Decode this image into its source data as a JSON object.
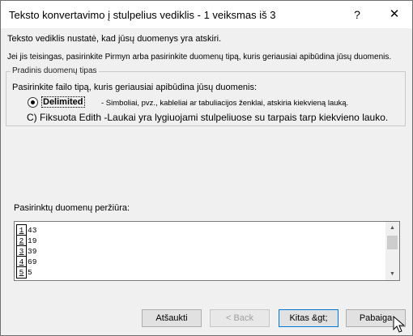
{
  "window": {
    "title": "Teksto konvertavimo į stulpelius vediklis - 1 veiksmas iš 3",
    "help_label": "?",
    "close_label": "✕"
  },
  "intro": {
    "line1": "Teksto vediklis nustatė, kad jūsų duomenys yra atskiri.",
    "line2": "Jei jis teisingas, pasirinkite Pirmyn arba pasirinkite duomenų tipą, kuris geriausiai apibūdina jūsų duomenis."
  },
  "data_type_group": {
    "legend": "Pradinis duomenų tipas",
    "prompt": "Pasirinkite failo tipą, kuris geriausiai apibūdina jūsų duomenis:",
    "delimited_label": "Delimited",
    "delimited_desc": "- Simboliai, pvz., kableliai ar tabuliacijos ženklai, atskiria kiekvieną lauką.",
    "fixed_line": "C) Fiksuota Edith -Laukai yra lygiuojami stulpeliuose su tarpais tarp kiekvieno lauko."
  },
  "preview": {
    "label": "Pasirinktų duomenų peržiūra:",
    "rows": [
      {
        "n": "1",
        "v": "43"
      },
      {
        "n": "2",
        "v": "19"
      },
      {
        "n": "3",
        "v": "39"
      },
      {
        "n": "4",
        "v": "69"
      },
      {
        "n": "5",
        "v": "5"
      }
    ],
    "scroll_up": "▲",
    "scroll_down": "▼"
  },
  "buttons": {
    "cancel": "Atšaukti",
    "back": "< Back",
    "next": "Kitas &gt;",
    "finish": "Pabaiga"
  }
}
